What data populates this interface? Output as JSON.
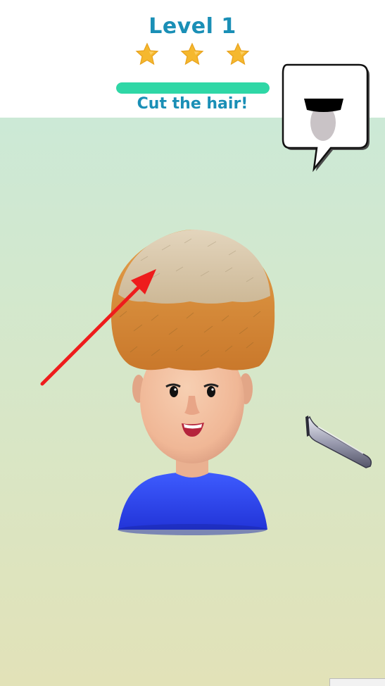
{
  "header": {
    "level_label": "Level 1",
    "instruction": "Cut the hair!",
    "stars_earned": 3,
    "stars_total": 3,
    "progress": 1.0
  },
  "target_preview": {
    "icon": "target-haircut-icon"
  },
  "tools": {
    "clipper_icon": "hair-clipper-icon"
  },
  "hint": {
    "icon": "red-arrow-icon"
  },
  "colors": {
    "accent_text": "#1a8fb6",
    "progress": "#2fd7a6",
    "star": "#f5b82e",
    "shirt": "#2f4cf0",
    "hair_light": "#d8c6a8",
    "hair_dark": "#d9913a",
    "arrow": "#ee1c1c"
  }
}
